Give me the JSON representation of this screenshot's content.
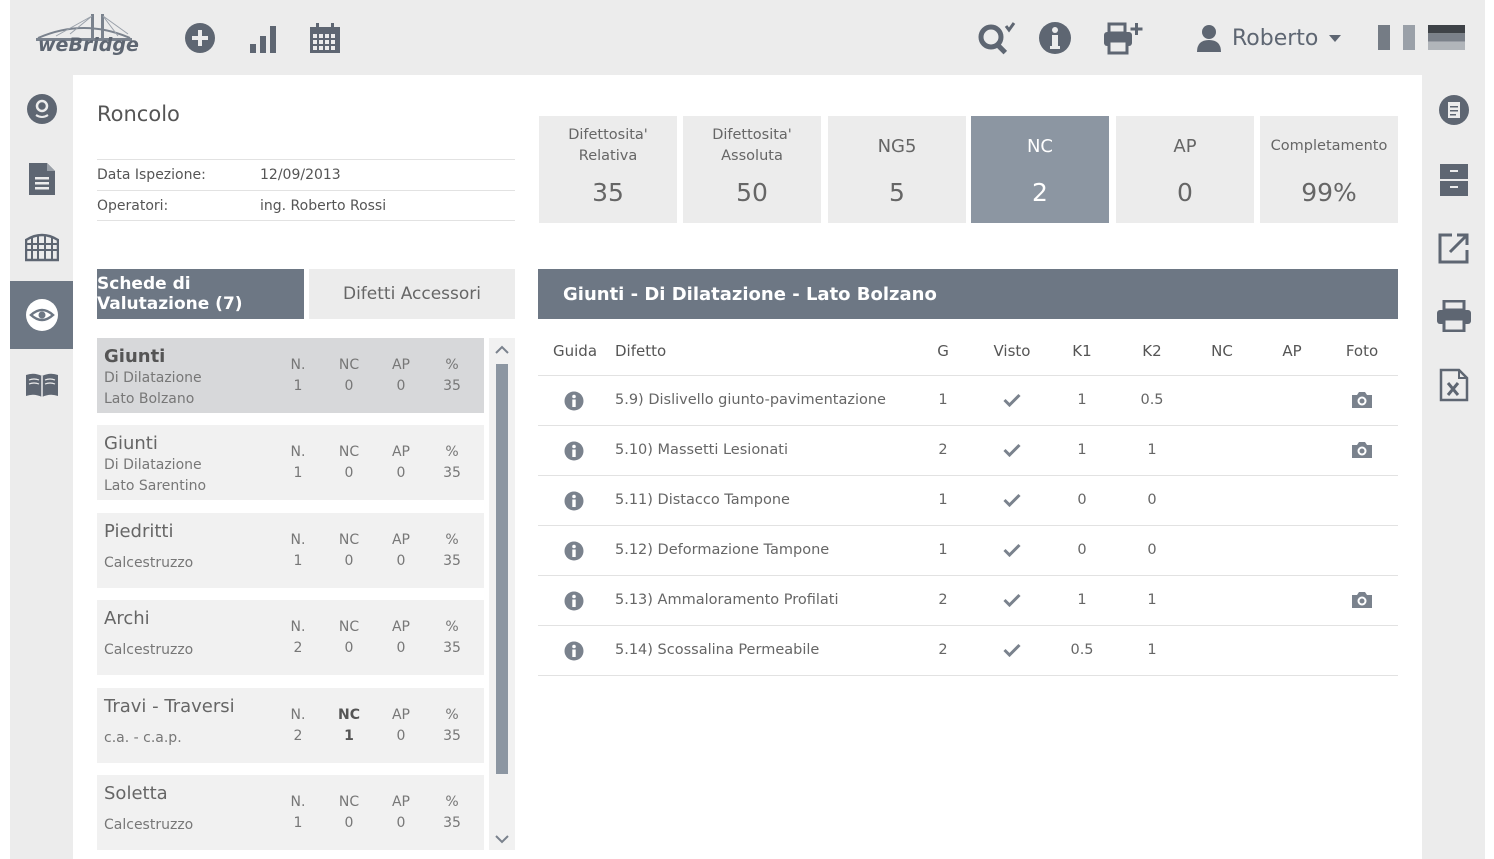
{
  "app": {
    "logo_text": "weBridge"
  },
  "user": {
    "name": "Roberto"
  },
  "header": {
    "title": "Roncolo",
    "inspection_label": "Data Ispezione:",
    "inspection_date": "12/09/2013",
    "operators_label": "Operatori:",
    "operators": "ing. Roberto Rossi"
  },
  "stats": [
    {
      "label": "Difettosita'\nRelativa",
      "value": "35",
      "big": false,
      "active": false
    },
    {
      "label": "Difettosita'\nAssoluta",
      "value": "50",
      "big": false,
      "active": false
    },
    {
      "label": "NG5",
      "value": "5",
      "big": true,
      "active": false
    },
    {
      "label": "NC",
      "value": "2",
      "big": true,
      "active": true
    },
    {
      "label": "AP",
      "value": "0",
      "big": true,
      "active": false
    },
    {
      "label": "Completamento",
      "value": "99%",
      "big": false,
      "active": false
    }
  ],
  "tabs": {
    "active": "Schede di Valutazione (7)",
    "inactive": "Difetti Accessori"
  },
  "card_headers": {
    "n": "N.",
    "nc": "NC",
    "ap": "AP",
    "pct": "%"
  },
  "cards": [
    {
      "title": "Giunti",
      "sub1": "Di Dilatazione",
      "sub2": "Lato Bolzano",
      "n": "1",
      "nc": "0",
      "ap": "0",
      "pct": "35",
      "selected": true,
      "nc_strong": false
    },
    {
      "title": "Giunti",
      "sub1": "Di Dilatazione",
      "sub2": "Lato Sarentino",
      "n": "1",
      "nc": "0",
      "ap": "0",
      "pct": "35",
      "selected": false,
      "nc_strong": false
    },
    {
      "title": "Piedritti",
      "sub1": "Calcestruzzo",
      "sub2": "",
      "n": "1",
      "nc": "0",
      "ap": "0",
      "pct": "35",
      "selected": false,
      "nc_strong": false
    },
    {
      "title": "Archi",
      "sub1": "Calcestruzzo",
      "sub2": "",
      "n": "2",
      "nc": "0",
      "ap": "0",
      "pct": "35",
      "selected": false,
      "nc_strong": false
    },
    {
      "title": "Travi - Traversi",
      "sub1": "c.a. - c.a.p.",
      "sub2": "",
      "n": "2",
      "nc": "1",
      "ap": "0",
      "pct": "35",
      "selected": false,
      "nc_strong": true
    },
    {
      "title": "Soletta",
      "sub1": "Calcestruzzo",
      "sub2": "",
      "n": "1",
      "nc": "0",
      "ap": "0",
      "pct": "35",
      "selected": false,
      "nc_strong": false
    }
  ],
  "detail": {
    "title": "Giunti  -  Di Dilatazione  -  Lato Bolzano",
    "columns": {
      "guida": "Guida",
      "difetto": "Difetto",
      "g": "G",
      "visto": "Visto",
      "k1": "K1",
      "k2": "K2",
      "nc": "NC",
      "ap": "AP",
      "foto": "Foto"
    },
    "rows": [
      {
        "difetto": "5.9) Dislivello giunto-pavimentazione",
        "g": "1",
        "visto": true,
        "k1": "1",
        "k2": "0.5",
        "nc": "",
        "ap": "",
        "foto": true
      },
      {
        "difetto": "5.10) Massetti Lesionati",
        "g": "2",
        "visto": true,
        "k1": "1",
        "k2": "1",
        "nc": "",
        "ap": "",
        "foto": true
      },
      {
        "difetto": "5.11) Distacco Tampone",
        "g": "1",
        "visto": true,
        "k1": "0",
        "k2": "0",
        "nc": "",
        "ap": "",
        "foto": false
      },
      {
        "difetto": "5.12) Deformazione Tampone",
        "g": "1",
        "visto": true,
        "k1": "0",
        "k2": "0",
        "nc": "",
        "ap": "",
        "foto": false
      },
      {
        "difetto": "5.13) Ammaloramento Profilati",
        "g": "2",
        "visto": true,
        "k1": "1",
        "k2": "1",
        "nc": "",
        "ap": "",
        "foto": true
      },
      {
        "difetto": "5.14) Scossalina Permeabile",
        "g": "2",
        "visto": true,
        "k1": "0.5",
        "k2": "1",
        "nc": "",
        "ap": "",
        "foto": false
      }
    ]
  },
  "colors": {
    "accent": "#6d7784",
    "active_stat": "#8c96a2",
    "panel": "#ececec",
    "icon": "#5e6672"
  },
  "icons": {
    "top": [
      "plus-circle-icon",
      "bar-chart-icon",
      "calendar-icon",
      "search-icon",
      "info-icon",
      "printer-plus-icon",
      "user-icon"
    ],
    "left": [
      "location-pin-icon",
      "document-icon",
      "bridge-icon",
      "eye-icon",
      "book-icon"
    ],
    "right": [
      "report-icon",
      "archive-icon",
      "external-link-icon",
      "print-icon",
      "excel-icon"
    ]
  }
}
